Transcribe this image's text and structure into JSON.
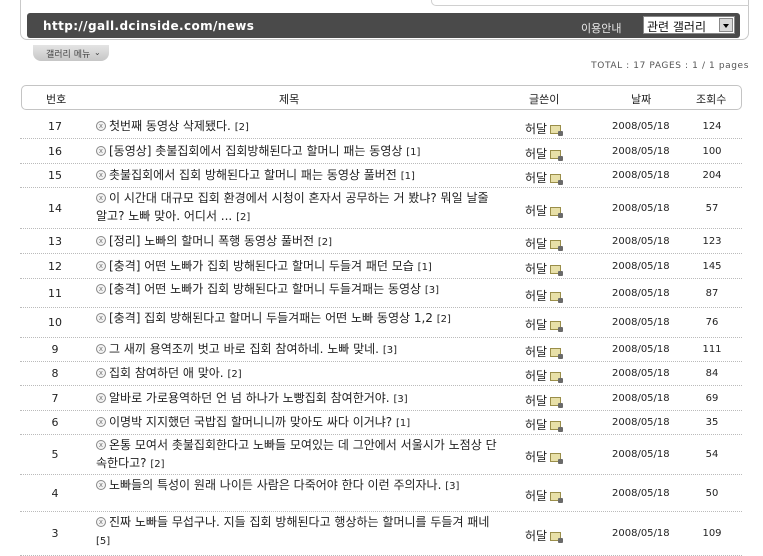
{
  "header": {
    "url": "http://gall.dcinside.com/news",
    "guide_label": "이용안내",
    "related_select": "관련 갤러리"
  },
  "gallery_menu": {
    "label": "갤러리 메뉴",
    "icon": "chevron-down-icon"
  },
  "summary": {
    "text": "TOTAL : 17 PAGES : 1 / 1 pages"
  },
  "columns": {
    "no": "번호",
    "title": "제목",
    "writer": "글쓴이",
    "date": "날짜",
    "views": "조회수"
  },
  "rows": [
    {
      "no": "17",
      "title": "첫번째 동영상 삭제됐다.",
      "comments": "[2]",
      "writer": "허달",
      "date": "2008/05/18",
      "views": "124"
    },
    {
      "no": "16",
      "title": "[동영상] 촛불집회에서 집회방해된다고 할머니 패는 동영상",
      "comments": "[1]",
      "writer": "허달",
      "date": "2008/05/18",
      "views": "100"
    },
    {
      "no": "15",
      "title": "촛불집회에서 집회 방해된다고 할머니 패는 동영상 풀버전",
      "comments": "[1]",
      "writer": "허달",
      "date": "2008/05/18",
      "views": "204"
    },
    {
      "no": "14",
      "title": "이 시간대 대규모 집회 환경에서 시청이 혼자서 공무하는 거 봤냐? 뭐일 날줄 알고? 노빠 맞아. 어디서 ...",
      "comments": "[2]",
      "writer": "허달",
      "date": "2008/05/18",
      "views": "57"
    },
    {
      "no": "13",
      "title": "[정리] 노빠의 할머니 폭행 동영상 풀버전",
      "comments": "[2]",
      "writer": "허달",
      "date": "2008/05/18",
      "views": "123"
    },
    {
      "no": "12",
      "title": "[충격] 어떤 노빠가 집회 방해된다고 할머니 두들겨 패던 모습",
      "comments": "[1]",
      "writer": "허달",
      "date": "2008/05/18",
      "views": "145"
    },
    {
      "no": "11",
      "title": "[충격] 어떤 노빠가 집회 방해된다고 할머니 두들겨패는 동영상",
      "comments": "[3]",
      "writer": "허달",
      "date": "2008/05/18",
      "views": "87"
    },
    {
      "no": "10",
      "title": "[충격] 집회 방해된다고 할머니 두들겨패는 어떤 노빠 동영상 1,2",
      "comments": "[2]",
      "writer": "허달",
      "date": "2008/05/18",
      "views": "76"
    },
    {
      "no": "9",
      "title": "그 새끼 용역조끼 벗고 바로 집회 참여하네. 노빠 맞네.",
      "comments": "[3]",
      "writer": "허달",
      "date": "2008/05/18",
      "views": "111"
    },
    {
      "no": "8",
      "title": "집회 참여하던 애 맞아.",
      "comments": "[2]",
      "writer": "허달",
      "date": "2008/05/18",
      "views": "84"
    },
    {
      "no": "7",
      "title": "알바로 가로용역하던 언 넘 하나가 노빵집회 참여한거야.",
      "comments": "[3]",
      "writer": "허달",
      "date": "2008/05/18",
      "views": "69"
    },
    {
      "no": "6",
      "title": "이명박 지지했던 국밥집 할머니니까 맞아도 싸다 이거냐?",
      "comments": "[1]",
      "writer": "허달",
      "date": "2008/05/18",
      "views": "35"
    },
    {
      "no": "5",
      "title": "온통 모여서 촛불집회한다고 노빠들 모여있는 데 그안에서 서울시가 노점상 단속한다고?",
      "comments": "[2]",
      "writer": "허달",
      "date": "2008/05/18",
      "views": "54"
    },
    {
      "no": "4",
      "title": "노빠들의 특성이 원래 나이든 사람은 다죽어야 한다 이런 주의자나.",
      "comments": "[3]",
      "writer": "허달",
      "date": "2008/05/18",
      "views": "50"
    },
    {
      "no": "3",
      "title": "진짜 노빠들 무섭구나. 지들 집회 방해된다고 행상하는 할머니를 두들겨 패네",
      "comments": "[5]",
      "writer": "허달",
      "date": "2008/05/18",
      "views": "109"
    }
  ]
}
